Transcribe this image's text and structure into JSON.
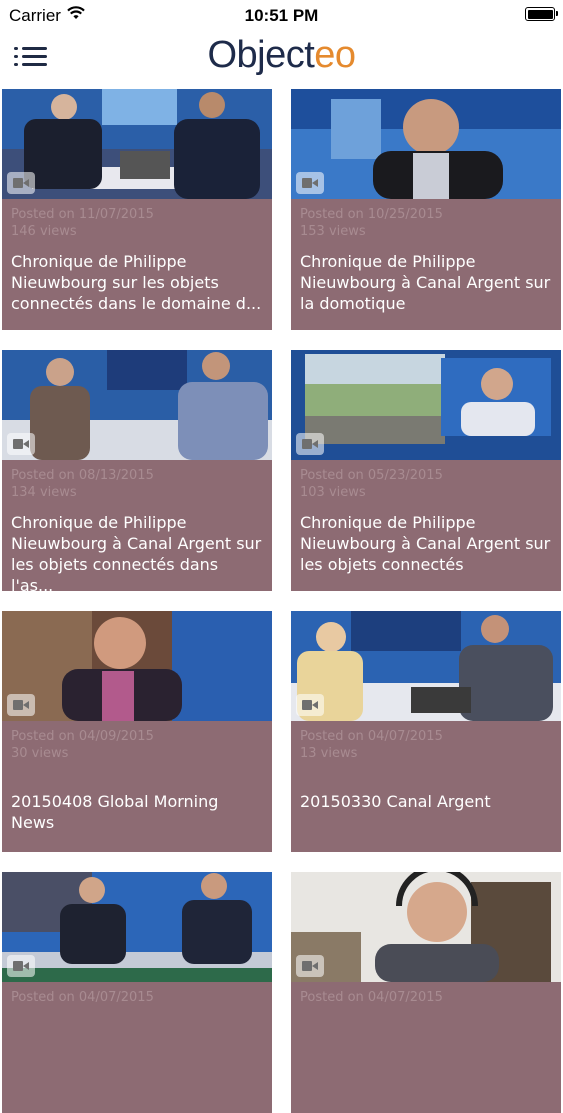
{
  "status_bar": {
    "carrier": "Carrier",
    "time": "10:51 PM"
  },
  "header": {
    "logo_main": "Object",
    "logo_accent": "eo"
  },
  "videos": [
    {
      "posted": "Posted on 11/07/2015",
      "views": "146 views",
      "title": "Chronique de Philippe Nieuwbourg sur les objets connectés dans le domaine d..."
    },
    {
      "posted": "Posted on 10/25/2015",
      "views": "153 views",
      "title": "Chronique de Philippe Nieuwbourg à Canal Argent sur la domotique"
    },
    {
      "posted": "Posted on 08/13/2015",
      "views": "134 views",
      "title": "Chronique de Philippe Nieuwbourg à Canal Argent sur les objets connectés dans l'as..."
    },
    {
      "posted": "Posted on 05/23/2015",
      "views": "103 views",
      "title": "Chronique de Philippe Nieuwbourg à Canal Argent sur les objets connectés"
    },
    {
      "posted": "Posted on 04/09/2015",
      "views": "30 views",
      "title": "20150408 Global Morning News"
    },
    {
      "posted": "Posted on 04/07/2015",
      "views": "13 views",
      "title": "20150330 Canal Argent"
    },
    {
      "posted": "Posted on 04/07/2015",
      "views": "",
      "title": ""
    },
    {
      "posted": "Posted on 04/07/2015",
      "views": "",
      "title": ""
    }
  ],
  "colors": {
    "card_background": "#8d6b73",
    "meta_text": "#a88b91",
    "logo_dark": "#1e2b4a",
    "logo_accent": "#e58a2e"
  },
  "icons": {
    "menu": "hamburger-menu-icon",
    "video": "video-camera-icon",
    "wifi": "wifi-icon",
    "battery": "battery-icon"
  }
}
